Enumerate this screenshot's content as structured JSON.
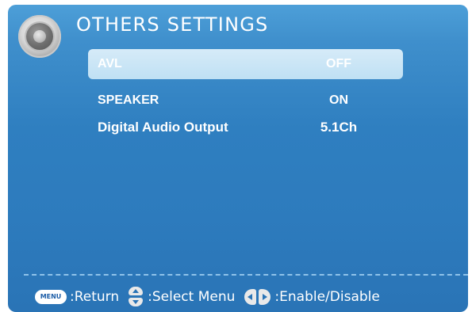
{
  "header": {
    "title": "OTHERS SETTINGS",
    "icon": "speaker-icon"
  },
  "menu": {
    "items": [
      {
        "label": "AVL",
        "value": "OFF",
        "selected": true
      },
      {
        "label": "SPEAKER",
        "value": "ON",
        "selected": false
      },
      {
        "label": "Digital Audio Output",
        "value": "5.1Ch",
        "selected": false
      }
    ]
  },
  "footer": {
    "menu_key": "MENU",
    "return_label": ":Return",
    "select_label": ":Select Menu",
    "enable_label": ":Enable/Disable"
  },
  "colors": {
    "background": "#2f7fc0",
    "highlight": "#c8e4f6",
    "text": "#ffffff"
  }
}
